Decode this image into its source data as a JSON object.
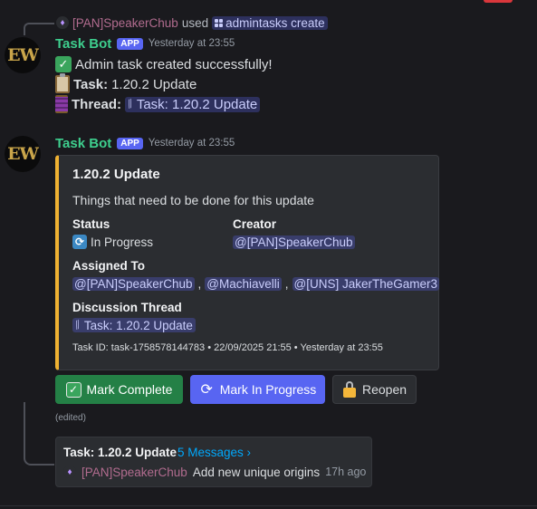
{
  "reply": {
    "user": "[PAN]SpeakerChub",
    "verb": "used",
    "command": "admintasks create"
  },
  "message1": {
    "avatar_text": "EW",
    "author": "Task Bot",
    "badge": "APP",
    "timestamp": "Yesterday at 23:55",
    "line1": "Admin task created successfully!",
    "line2_label": "Task:",
    "line2_value": "1.20.2 Update",
    "line3_label": "Thread:",
    "line3_value": "Task: 1.20.2 Update"
  },
  "message2": {
    "avatar_text": "EW",
    "author": "Task Bot",
    "badge": "APP",
    "timestamp": "Yesterday at 23:55",
    "embed": {
      "accent": "#f0b232",
      "title": "1.20.2 Update",
      "description": "Things that need to be done for this update",
      "fields": {
        "status_name": "Status",
        "status_value": "In Progress",
        "creator_name": "Creator",
        "creator_value": "@[PAN]SpeakerChub",
        "assigned_name": "Assigned To",
        "assigned": [
          "@[PAN]SpeakerChub",
          "@Machiavelli",
          "@[UNS] JakerTheGamer3"
        ],
        "separator": ",",
        "thread_name": "Discussion Thread",
        "thread_value": "Task: 1.20.2 Update"
      },
      "footer": "Task ID: task-1758578144783 • 22/09/2025 21:55 • Yesterday at 23:55"
    },
    "buttons": {
      "complete": "Mark Complete",
      "in_progress": "Mark In Progress",
      "reopen": "Reopen"
    },
    "edited": "(edited)"
  },
  "thread_summary": {
    "name": "Task: 1.20.2 Update",
    "count": "5 Messages ›",
    "last_user": "[PAN]SpeakerChub",
    "last_text": "Add new unique origins",
    "last_time": "17h ago"
  },
  "colors": {
    "background": "#1a1a1e",
    "bot_name": "#3ecf8e",
    "brand": "#5865f2",
    "success": "#248046",
    "link": "#00a8fc"
  },
  "icons": {
    "check": "check-mark-button-icon",
    "clipboard": "clipboard-icon",
    "thread": "thread-spool-icon",
    "sync": "counterclockwise-arrows-icon",
    "lock": "unlocked-padlock-icon"
  }
}
